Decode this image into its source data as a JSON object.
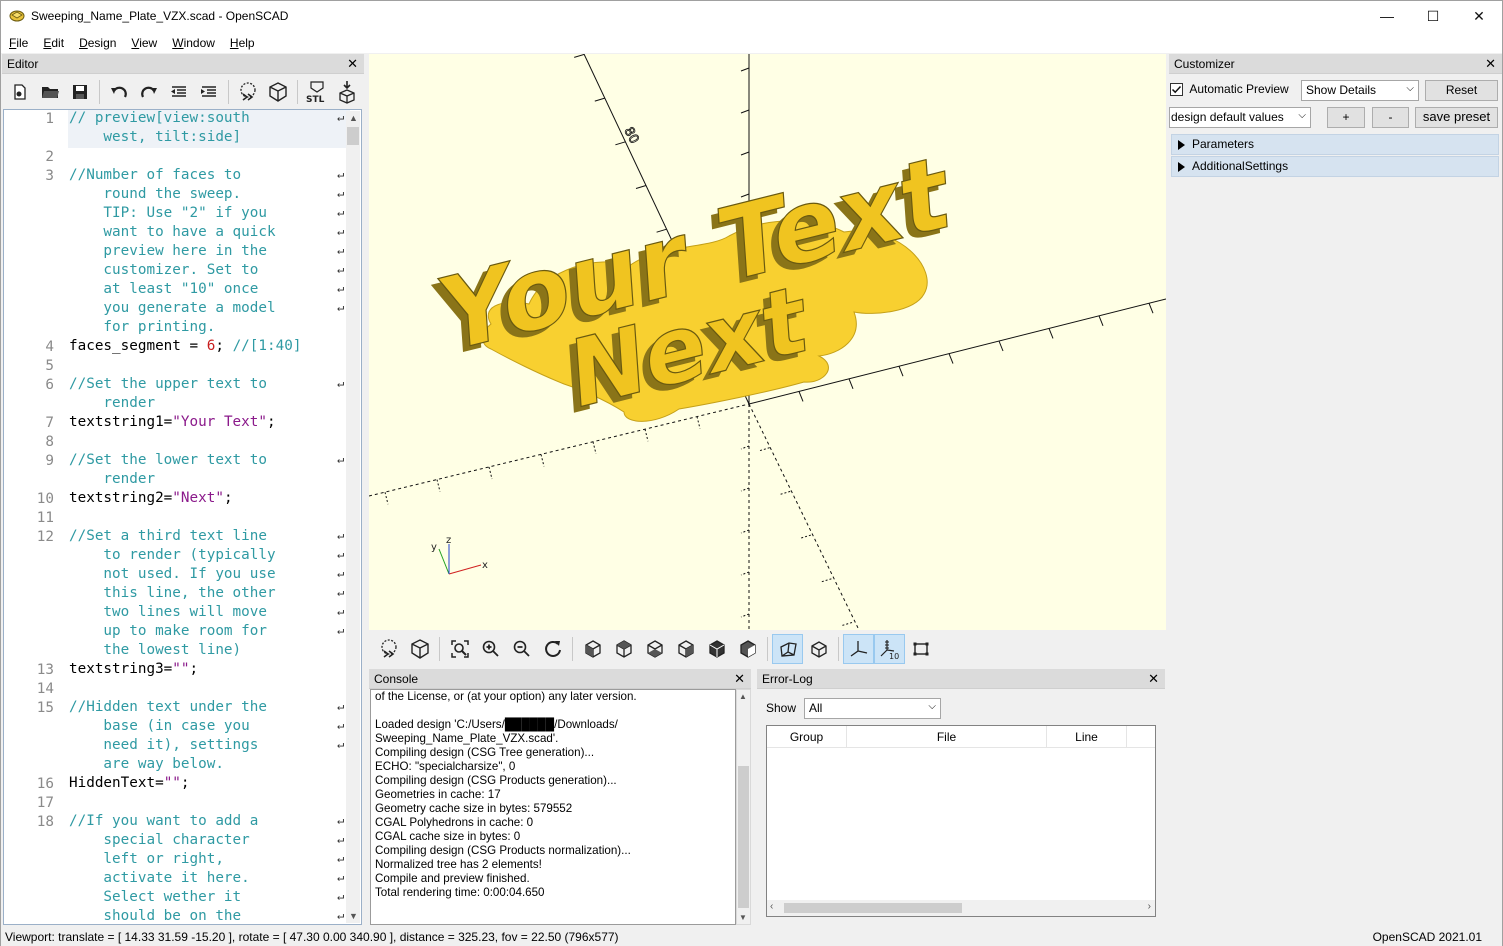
{
  "window": {
    "title": "Sweeping_Name_Plate_VZX.scad - OpenSCAD",
    "min_glyph": "—",
    "max_glyph": "☐",
    "close_glyph": "✕"
  },
  "menu": [
    "File",
    "Edit",
    "Design",
    "View",
    "Window",
    "Help"
  ],
  "editor": {
    "title": "Editor",
    "close": "✕",
    "lines": [
      {
        "n": "1",
        "segs": [
          {
            "t": "// preview[view:south",
            "c": "cm"
          }
        ],
        "wrap": true
      },
      {
        "n": "",
        "segs": [
          {
            "t": "    west, tilt:side]",
            "c": "cm"
          }
        ]
      },
      {
        "n": "2",
        "segs": []
      },
      {
        "n": "3",
        "segs": [
          {
            "t": "//Number of faces to",
            "c": "cm"
          }
        ],
        "wrap": true
      },
      {
        "n": "",
        "segs": [
          {
            "t": "    round the sweep.",
            "c": "cm"
          }
        ],
        "wrap": true
      },
      {
        "n": "",
        "segs": [
          {
            "t": "    TIP: Use \"2\" if you",
            "c": "cm"
          }
        ],
        "wrap": true
      },
      {
        "n": "",
        "segs": [
          {
            "t": "    want to have a quick",
            "c": "cm"
          }
        ],
        "wrap": true
      },
      {
        "n": "",
        "segs": [
          {
            "t": "    preview here in the",
            "c": "cm"
          }
        ],
        "wrap": true
      },
      {
        "n": "",
        "segs": [
          {
            "t": "    customizer. Set to",
            "c": "cm"
          }
        ],
        "wrap": true
      },
      {
        "n": "",
        "segs": [
          {
            "t": "    at least \"10\" once",
            "c": "cm"
          }
        ],
        "wrap": true
      },
      {
        "n": "",
        "segs": [
          {
            "t": "    you generate a model",
            "c": "cm"
          }
        ],
        "wrap": true
      },
      {
        "n": "",
        "segs": [
          {
            "t": "    for printing.",
            "c": "cm"
          }
        ]
      },
      {
        "n": "4",
        "segs": [
          {
            "t": "faces_segment = ",
            "c": ""
          },
          {
            "t": "6",
            "c": "nm"
          },
          {
            "t": "; ",
            "c": ""
          },
          {
            "t": "//[1:40]",
            "c": "cm"
          }
        ]
      },
      {
        "n": "5",
        "segs": []
      },
      {
        "n": "6",
        "segs": [
          {
            "t": "//Set the upper text to",
            "c": "cm"
          }
        ],
        "wrap": true
      },
      {
        "n": "",
        "segs": [
          {
            "t": "    render",
            "c": "cm"
          }
        ]
      },
      {
        "n": "7",
        "segs": [
          {
            "t": "textstring1=",
            "c": ""
          },
          {
            "t": "\"Your Text\"",
            "c": "st"
          },
          {
            "t": ";",
            "c": ""
          }
        ]
      },
      {
        "n": "8",
        "segs": []
      },
      {
        "n": "9",
        "segs": [
          {
            "t": "//Set the lower text to",
            "c": "cm"
          }
        ],
        "wrap": true
      },
      {
        "n": "",
        "segs": [
          {
            "t": "    render",
            "c": "cm"
          }
        ]
      },
      {
        "n": "10",
        "segs": [
          {
            "t": "textstring2=",
            "c": ""
          },
          {
            "t": "\"Next\"",
            "c": "st"
          },
          {
            "t": ";",
            "c": ""
          }
        ]
      },
      {
        "n": "11",
        "segs": []
      },
      {
        "n": "12",
        "segs": [
          {
            "t": "//Set a third text line",
            "c": "cm"
          }
        ],
        "wrap": true
      },
      {
        "n": "",
        "segs": [
          {
            "t": "    to render (typically",
            "c": "cm"
          }
        ],
        "wrap": true
      },
      {
        "n": "",
        "segs": [
          {
            "t": "    not used. If you use",
            "c": "cm"
          }
        ],
        "wrap": true
      },
      {
        "n": "",
        "segs": [
          {
            "t": "    this line, the other",
            "c": "cm"
          }
        ],
        "wrap": true
      },
      {
        "n": "",
        "segs": [
          {
            "t": "    two lines will move",
            "c": "cm"
          }
        ],
        "wrap": true
      },
      {
        "n": "",
        "segs": [
          {
            "t": "    up to make room for",
            "c": "cm"
          }
        ],
        "wrap": true
      },
      {
        "n": "",
        "segs": [
          {
            "t": "    the lowest line)",
            "c": "cm"
          }
        ]
      },
      {
        "n": "13",
        "segs": [
          {
            "t": "textstring3=",
            "c": ""
          },
          {
            "t": "\"\"",
            "c": "st"
          },
          {
            "t": ";",
            "c": ""
          }
        ]
      },
      {
        "n": "14",
        "segs": []
      },
      {
        "n": "15",
        "segs": [
          {
            "t": "//Hidden text under the",
            "c": "cm"
          }
        ],
        "wrap": true
      },
      {
        "n": "",
        "segs": [
          {
            "t": "    base (in case you",
            "c": "cm"
          }
        ],
        "wrap": true
      },
      {
        "n": "",
        "segs": [
          {
            "t": "    need it), settings",
            "c": "cm"
          }
        ],
        "wrap": true
      },
      {
        "n": "",
        "segs": [
          {
            "t": "    are way below.",
            "c": "cm"
          }
        ]
      },
      {
        "n": "16",
        "segs": [
          {
            "t": "HiddenText=",
            "c": ""
          },
          {
            "t": "\"\"",
            "c": "st"
          },
          {
            "t": ";",
            "c": ""
          }
        ]
      },
      {
        "n": "17",
        "segs": []
      },
      {
        "n": "18",
        "segs": [
          {
            "t": "//If you want to add a",
            "c": "cm"
          }
        ],
        "wrap": true
      },
      {
        "n": "",
        "segs": [
          {
            "t": "    special character",
            "c": "cm"
          }
        ],
        "wrap": true
      },
      {
        "n": "",
        "segs": [
          {
            "t": "    left or right,",
            "c": "cm"
          }
        ],
        "wrap": true
      },
      {
        "n": "",
        "segs": [
          {
            "t": "    activate it here.",
            "c": "cm"
          }
        ],
        "wrap": true
      },
      {
        "n": "",
        "segs": [
          {
            "t": "    Select wether it",
            "c": "cm"
          }
        ],
        "wrap": true
      },
      {
        "n": "",
        "segs": [
          {
            "t": "    should be on the",
            "c": "cm"
          }
        ],
        "wrap": true
      }
    ]
  },
  "viewport": {
    "model_line1": "Your Text",
    "model_line2": "Next",
    "axis_x": "x",
    "axis_y": "y",
    "axis_z": "z",
    "ruler_label": "80"
  },
  "customizer": {
    "title": "Customizer",
    "close": "✕",
    "auto_preview_label": "Automatic Preview",
    "auto_preview_checked": true,
    "details_select": "Show Details",
    "reset_label": "Reset",
    "preset_select": "design default values",
    "plus_label": "+",
    "minus_label": "-",
    "save_preset_label": "save preset",
    "groups": [
      "Parameters",
      "AdditionalSettings"
    ]
  },
  "console": {
    "title": "Console",
    "close": "✕",
    "lines": [
      "of the License, or (at your option) any later version.",
      "",
      "Loaded design 'C:/Users/██████/Downloads/",
      "Sweeping_Name_Plate_VZX.scad'.",
      "Compiling design (CSG Tree generation)...",
      "ECHO: \"specialcharsize\", 0",
      "Compiling design (CSG Products generation)...",
      "Geometries in cache: 17",
      "Geometry cache size in bytes: 579552",
      "CGAL Polyhedrons in cache: 0",
      "CGAL cache size in bytes: 0",
      "Compiling design (CSG Products normalization)...",
      "Normalized tree has 2 elements!",
      "Compile and preview finished.",
      "Total rendering time: 0:00:04.650"
    ]
  },
  "errorlog": {
    "title": "Error-Log",
    "close": "✕",
    "show_label": "Show",
    "show_value": "All",
    "columns": [
      "Group",
      "File",
      "Line"
    ]
  },
  "status": {
    "left": "Viewport: translate = [ 14.33 31.59 -15.20 ], rotate = [ 47.30 0.00 340.90 ], distance = 325.23, fov = 22.50 (796x577)",
    "right": "OpenSCAD 2021.01"
  },
  "colors": {
    "viewport_bg": "#ffffe5",
    "model": "#f8d030",
    "model_shade": "#8a7418",
    "comment": "#2f9aa3",
    "string": "#8b1a8b",
    "number": "#c81e1e"
  }
}
